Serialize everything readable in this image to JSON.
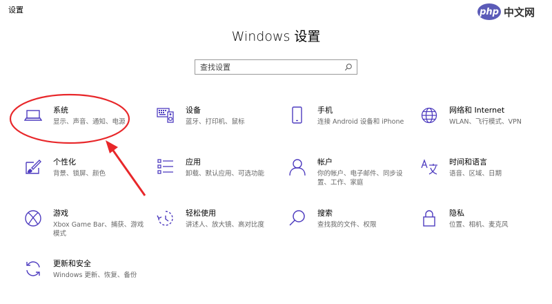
{
  "window": {
    "app_title": "设置"
  },
  "watermark": {
    "logo_text": "php",
    "site_text": "中文网"
  },
  "page": {
    "title": "Windows 设置"
  },
  "search": {
    "placeholder": "查找设置",
    "icon": "search-icon"
  },
  "accent_color": "#4d3bbf",
  "annotation_color": "#e8272a",
  "tiles": [
    {
      "title": "系统",
      "desc": [
        "显示、声音、通知、电源"
      ],
      "icon": "laptop-icon"
    },
    {
      "title": "设备",
      "desc": [
        "蓝牙、打印机、鼠标"
      ],
      "icon": "keyboard-speaker-icon"
    },
    {
      "title": "手机",
      "desc": [
        "连接 Android 设备和 iPhone"
      ],
      "icon": "phone-icon"
    },
    {
      "title": "网络和 Internet",
      "desc": [
        "WLAN、飞行模式、VPN"
      ],
      "icon": "globe-icon"
    },
    {
      "title": "个性化",
      "desc": [
        "背景、锁屏、颜色"
      ],
      "icon": "paint-brush-icon"
    },
    {
      "title": "应用",
      "desc": [
        "卸载、默认应用、可选功能"
      ],
      "icon": "apps-list-icon"
    },
    {
      "title": "帐户",
      "desc": [
        "你的帐户、电子邮件、同步设",
        "置、工作、家庭"
      ],
      "icon": "person-icon"
    },
    {
      "title": "时间和语言",
      "desc": [
        "语音、区域、日期"
      ],
      "icon": "time-language-icon"
    },
    {
      "title": "游戏",
      "desc": [
        "Xbox Game Bar、捕获、游戏",
        "模式"
      ],
      "icon": "xbox-icon"
    },
    {
      "title": "轻松使用",
      "desc": [
        "讲述人、放大镜、高对比度"
      ],
      "icon": "ease-of-access-icon"
    },
    {
      "title": "搜索",
      "desc": [
        "查找我的文件、权限"
      ],
      "icon": "magnifier-icon"
    },
    {
      "title": "隐私",
      "desc": [
        "位置、相机、麦克风"
      ],
      "icon": "lock-icon"
    },
    {
      "title": "更新和安全",
      "desc": [
        "Windows 更新、恢复、备份"
      ],
      "icon": "sync-icon"
    }
  ]
}
